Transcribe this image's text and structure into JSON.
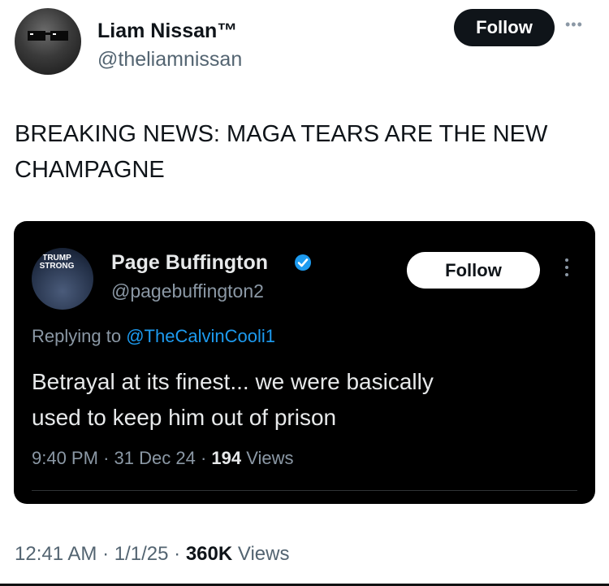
{
  "author": {
    "name": "Liam Nissan™",
    "handle": "@theliamnissan",
    "follow_label": "Follow",
    "avatar_icon": "sunglasses-avatar"
  },
  "tweet": {
    "text_line1": "BREAKING NEWS: MAGA TEARS ARE THE NEW",
    "text_line2": "CHAMPAGNE",
    "time": "12:41 AM",
    "date": "1/1/25",
    "views_count": "360K",
    "views_label": "Views"
  },
  "quoted": {
    "avatar_text_line1": "TRUMP",
    "avatar_text_line2": "STRONG",
    "name": "Page Buffington",
    "handle": "@pagebuffington2",
    "follow_label": "Follow",
    "replying_label": "Replying to",
    "replying_mention": "@TheCalvinCooli1",
    "text_line1": "Betrayal at its finest... we were basically",
    "text_line2": "used to keep him out of prison",
    "time": "9:40 PM",
    "date": "31 Dec 24",
    "views_count": "194",
    "views_label": "Views"
  },
  "colors": {
    "accent": "#1d9bf0",
    "text_primary": "#0f1419",
    "text_secondary": "#536471",
    "dark_card": "#000000"
  }
}
